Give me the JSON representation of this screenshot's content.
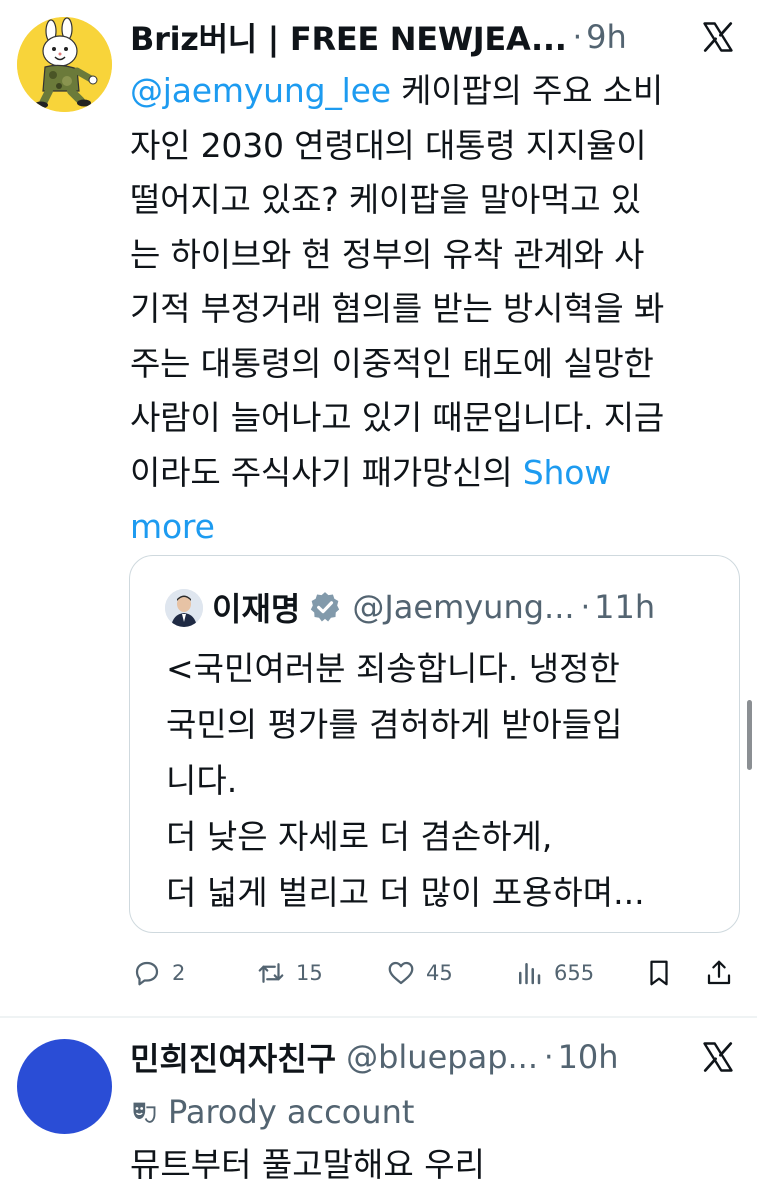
{
  "tweet1": {
    "display_name": "Briz버니 | FREE NEWJEA...",
    "separator": "·",
    "time": "9h",
    "mention": "@jaemyung_lee",
    "body_lines": [
      " 케이팝의 주요 소비",
      "자인 2030 연령대의 대통령 지지율이",
      "떨어지고 있죠? 케이팝을 말아먹고 있",
      "는 하이브와 현 정부의 유착 관계와 사",
      "기적 부정거래 혐의를 받는 방시혁을 봐",
      "주는 대통령의 이중적인 태도에 실망한",
      "사람이 늘어나고 있기 때문입니다. 지금",
      "이라도 주식사기 패가망신의 "
    ],
    "show_more_1": "Show",
    "show_more_2": "more",
    "quote": {
      "display_name": "이재명",
      "handle": "@Jaemyung...",
      "separator": "·",
      "time": "11h",
      "lines": [
        "<국민여러분 죄송합니다. 냉정한",
        "국민의 평가를 겸허하게 받아들입",
        "니다.",
        "더 낮은 자세로 더 겸손하게,",
        "더 넓게 벌리고 더 많이 포용하며..."
      ]
    },
    "actions": {
      "replies": "2",
      "reposts": "15",
      "likes": "45",
      "views": "655"
    }
  },
  "tweet2": {
    "display_name": "민희진여자친구",
    "handle": "@bluepap...",
    "separator": "·",
    "time": "10h",
    "parody_label": "Parody account",
    "body": "뮤트부터 풀고말해요 우리"
  },
  "colors": {
    "accent": "#1d9bf0",
    "secondary_text": "#536471",
    "avatar2": "#2a4dd6",
    "avatar1_bg": "#f8d43a"
  },
  "icons": [
    "x-logo-icon",
    "verified-badge-icon",
    "reply-icon",
    "repost-icon",
    "like-icon",
    "views-icon",
    "bookmark-icon",
    "share-icon",
    "parody-mask-icon"
  ]
}
